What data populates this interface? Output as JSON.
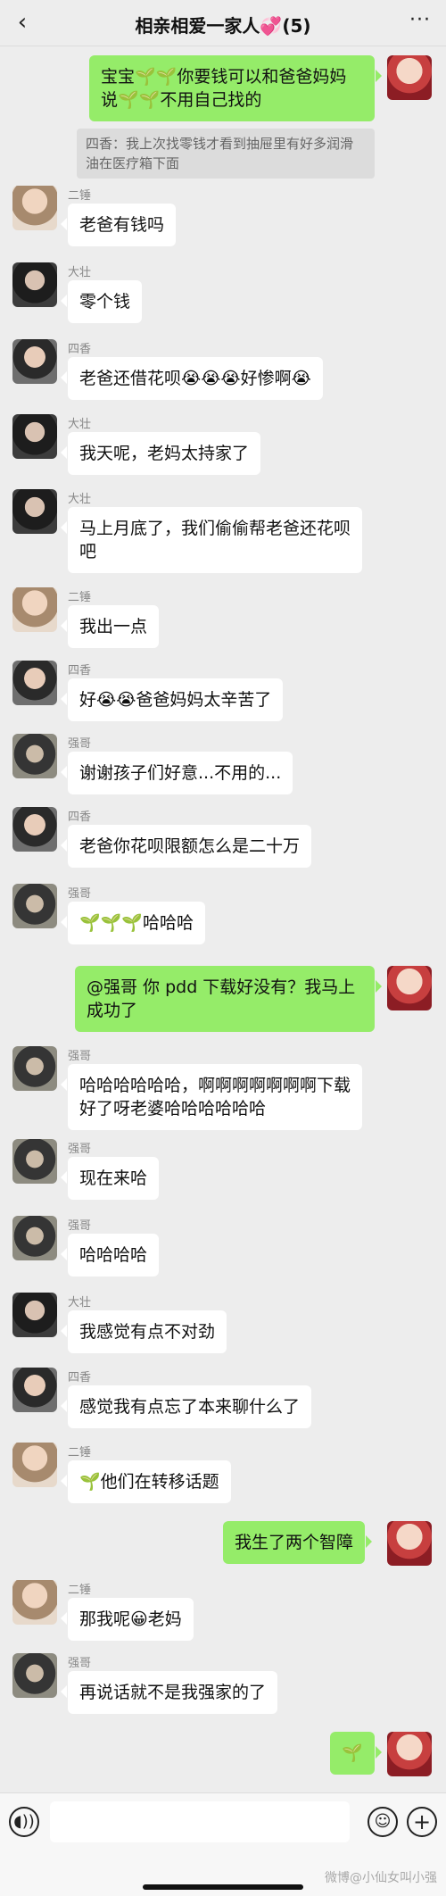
{
  "header": {
    "back_icon": "‹",
    "title": "相亲相爱一家人💞(5)",
    "more_icon": "···"
  },
  "messages": [
    {
      "id": "m1",
      "side": "out",
      "text": "宝宝🌱🌱你要钱可以和爸爸妈妈说🌱🌱不用自己找的"
    },
    {
      "id": "m1q",
      "type": "quote",
      "text": "四香：我上次找零钱才看到抽屉里有好多润滑油在医疗箱下面"
    },
    {
      "id": "m2",
      "side": "in",
      "sender": "二锤",
      "text": "老爸有钱吗"
    },
    {
      "id": "m3",
      "side": "in",
      "sender": "大壮",
      "text": "零个钱"
    },
    {
      "id": "m4",
      "side": "in",
      "sender": "四香",
      "text": "老爸还借花呗😭😭😭好惨啊😭"
    },
    {
      "id": "m5",
      "side": "in",
      "sender": "大壮",
      "text": "我天呢，老妈太持家了"
    },
    {
      "id": "m6",
      "side": "in",
      "sender": "大壮",
      "text": "马上月底了，我们偷偷帮老爸还花呗吧"
    },
    {
      "id": "m7",
      "side": "in",
      "sender": "二锤",
      "text": "我出一点"
    },
    {
      "id": "m8",
      "side": "in",
      "sender": "四香",
      "text": "好😭😭爸爸妈妈太辛苦了"
    },
    {
      "id": "m9",
      "side": "in",
      "sender": "强哥",
      "text": "谢谢孩子们好意...不用的..."
    },
    {
      "id": "m10",
      "side": "in",
      "sender": "四香",
      "text": "老爸你花呗限额怎么是二十万"
    },
    {
      "id": "m11",
      "side": "in",
      "sender": "强哥",
      "text": "🌱🌱🌱哈哈哈"
    },
    {
      "id": "m12",
      "side": "out",
      "text": "@强哥 你 pdd 下载好没有？我马上成功了"
    },
    {
      "id": "m13",
      "side": "in",
      "sender": "强哥",
      "text": "哈哈哈哈哈哈，啊啊啊啊啊啊啊下载好了呀老婆哈哈哈哈哈哈"
    },
    {
      "id": "m14",
      "side": "in",
      "sender": "强哥",
      "text": "现在来哈"
    },
    {
      "id": "m15",
      "side": "in",
      "sender": "强哥",
      "text": "哈哈哈哈"
    },
    {
      "id": "m16",
      "side": "in",
      "sender": "大壮",
      "text": "我感觉有点不对劲"
    },
    {
      "id": "m17",
      "side": "in",
      "sender": "四香",
      "text": "感觉我有点忘了本来聊什么了"
    },
    {
      "id": "m18",
      "side": "in",
      "sender": "二锤",
      "text": "🌱他们在转移话题"
    },
    {
      "id": "m19",
      "side": "out",
      "text": "我生了两个智障"
    },
    {
      "id": "m20",
      "side": "in",
      "sender": "二锤",
      "text": "那我呢😀老妈"
    },
    {
      "id": "m21",
      "side": "in",
      "sender": "强哥",
      "text": "再说话就不是我强家的了"
    },
    {
      "id": "m22",
      "side": "out",
      "text": "🌱"
    }
  ],
  "footer": {
    "voice_icon": "◖))",
    "emoji_icon": "☺",
    "plus_icon": "+",
    "input_value": "",
    "watermark": "微博@小仙女叫小强"
  }
}
